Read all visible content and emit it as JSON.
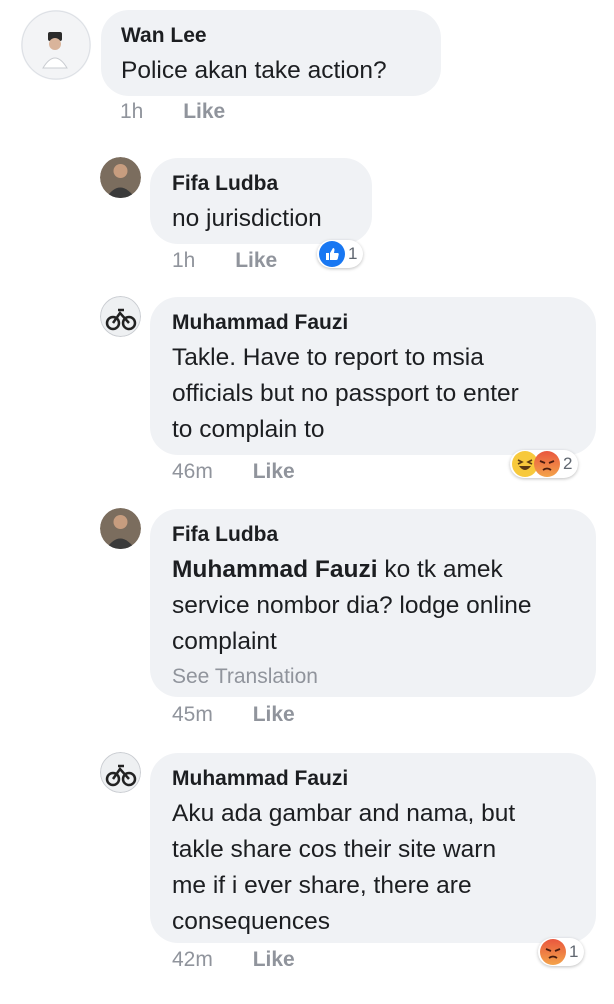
{
  "comments": [
    {
      "author": "Wan Lee",
      "text": "Police akan take action?",
      "time": "1h",
      "like_label": "Like"
    },
    {
      "author": "Fifa Ludba",
      "text": "no jurisdiction",
      "time": "1h",
      "like_label": "Like",
      "reactions": {
        "types": [
          "like"
        ],
        "count": "1"
      }
    },
    {
      "author": "Muhammad Fauzi",
      "lines": [
        "Takle. Have to report to msia",
        "officials but no passport to enter",
        "to complain to"
      ],
      "time": "46m",
      "like_label": "Like",
      "reactions": {
        "types": [
          "haha",
          "angry"
        ],
        "count": "2"
      }
    },
    {
      "author": "Fifa Ludba",
      "mention": "Muhammad Fauzi",
      "lines": [
        " ko tk amek",
        "service nombor dia? lodge online",
        "complaint"
      ],
      "see_translation": "See Translation",
      "time": "45m",
      "like_label": "Like"
    },
    {
      "author": "Muhammad Fauzi",
      "lines": [
        "Aku ada gambar and nama, but",
        "takle share cos their site warn",
        "me if i ever share, there are",
        "consequences"
      ],
      "time": "42m",
      "like_label": "Like",
      "reactions": {
        "types": [
          "angry"
        ],
        "count": "1"
      }
    }
  ],
  "colors": {
    "bubble": "#f0f2f5",
    "meta_text": "#90949c",
    "like_blue": "#1877f2",
    "haha_yellow": "#f7c93c",
    "angry_red": "#e9573e"
  }
}
